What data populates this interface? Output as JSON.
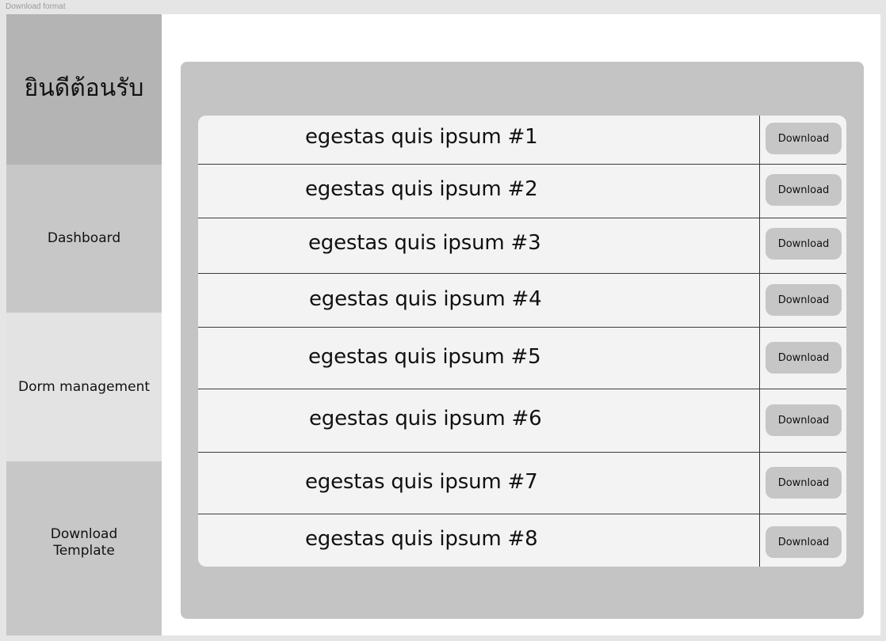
{
  "frame": {
    "label": "Download format"
  },
  "sidebar": {
    "welcome": "ยินดีต้อนรับ",
    "items": [
      {
        "label": "Dashboard"
      },
      {
        "label": "Dorm management"
      },
      {
        "label": "Download\nTemplate"
      }
    ]
  },
  "downloads": {
    "button_label": "Download",
    "rows": [
      {
        "title": "egestas quis ipsum #1",
        "button": "Download"
      },
      {
        "title": "egestas quis ipsum #2",
        "button": "Download"
      },
      {
        "title": "egestas quis ipsum #3",
        "button": "Download"
      },
      {
        "title": "egestas quis ipsum #4",
        "button": "Download"
      },
      {
        "title": "egestas quis ipsum #5",
        "button": "Download"
      },
      {
        "title": "egestas quis ipsum #6",
        "button": "Download"
      },
      {
        "title": "egestas quis ipsum #7",
        "button": "Download"
      },
      {
        "title": "egestas quis ipsum #8",
        "button": "Download"
      }
    ]
  },
  "colors": {
    "page_bg": "#e5e5e5",
    "sidebar_welcome": "#b4b4b4",
    "sidebar_item": "#c7c7c7",
    "sidebar_item_active": "#e3e3e3",
    "panel": "#c4c4c4",
    "list_bg": "#f3f3f3",
    "button_bg": "#c6c6c6"
  }
}
